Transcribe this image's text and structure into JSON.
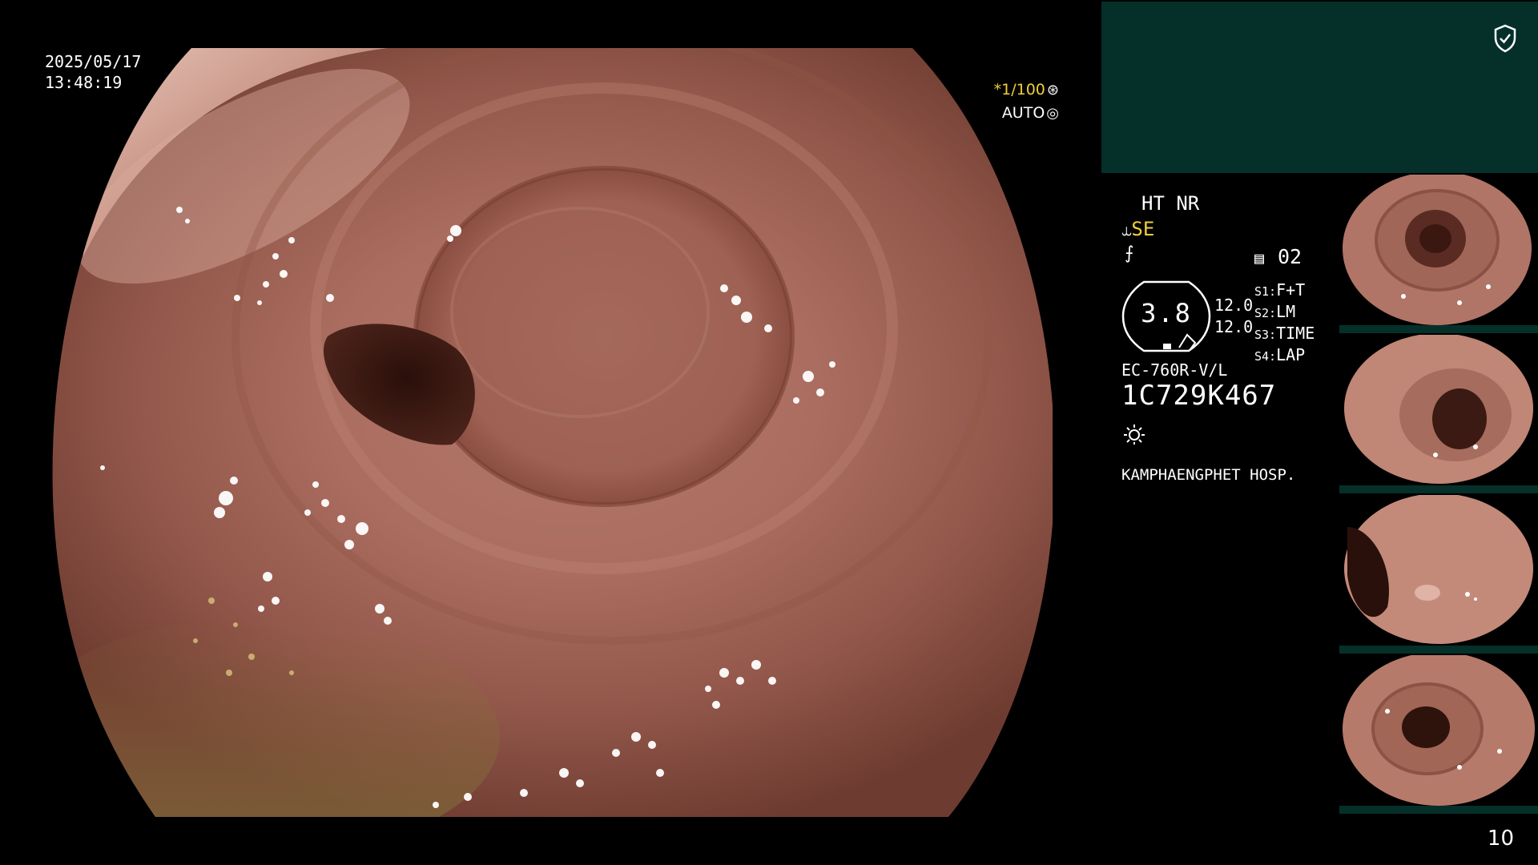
{
  "overlay": {
    "date": "2025/05/17",
    "time": "13:48:19",
    "shutter": "*1/100",
    "exposure_mode": "AUTO"
  },
  "info_panel": {
    "enhance": "HT NR",
    "structure_enhance": "SE",
    "mode_number": "02",
    "zoom": "3.8",
    "sharpness_1": "12.0",
    "sharpness_2": "12.0",
    "switches": [
      {
        "key": "S1:",
        "value": "F+T"
      },
      {
        "key": "S2:",
        "value": "LM"
      },
      {
        "key": "S3:",
        "value": "TIME"
      },
      {
        "key": "S4:",
        "value": "LAP"
      }
    ],
    "scope_model": "EC-760R-V/L",
    "scope_serial": "1C729K467",
    "hospital": "KAMPHAENGPHET HOSP."
  },
  "page_number": "10",
  "icons": {
    "shield": "shield-check-icon",
    "light": "light-source-icon",
    "iris": "iris-icon",
    "shutter": "shutter-icon"
  },
  "colors": {
    "panel_bg": "#05302a",
    "highlight_yellow": "#f0cf3a",
    "mucosa": "#a96b5e"
  }
}
